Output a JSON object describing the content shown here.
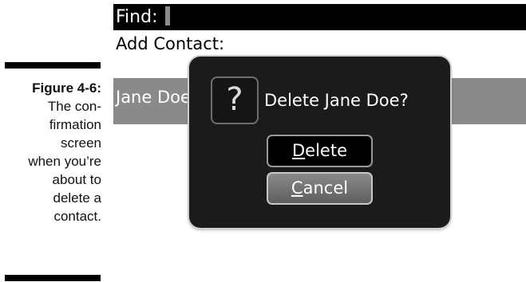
{
  "figure": {
    "label": "Figure 4-6:",
    "caption": "The con-\nfirmation\nscreen\nwhen you’re\nabout to\ndelete a\ncontact."
  },
  "screen": {
    "find_label": "Find:",
    "add_contact_label": "Add Contact:",
    "contact_name": "Jane Doe"
  },
  "dialog": {
    "icon": "question-mark-icon",
    "message": "Delete Jane Doe?",
    "delete_button": {
      "mnemonic": "D",
      "rest": "elete"
    },
    "cancel_button": {
      "mnemonic": "C",
      "rest": "ancel"
    }
  }
}
